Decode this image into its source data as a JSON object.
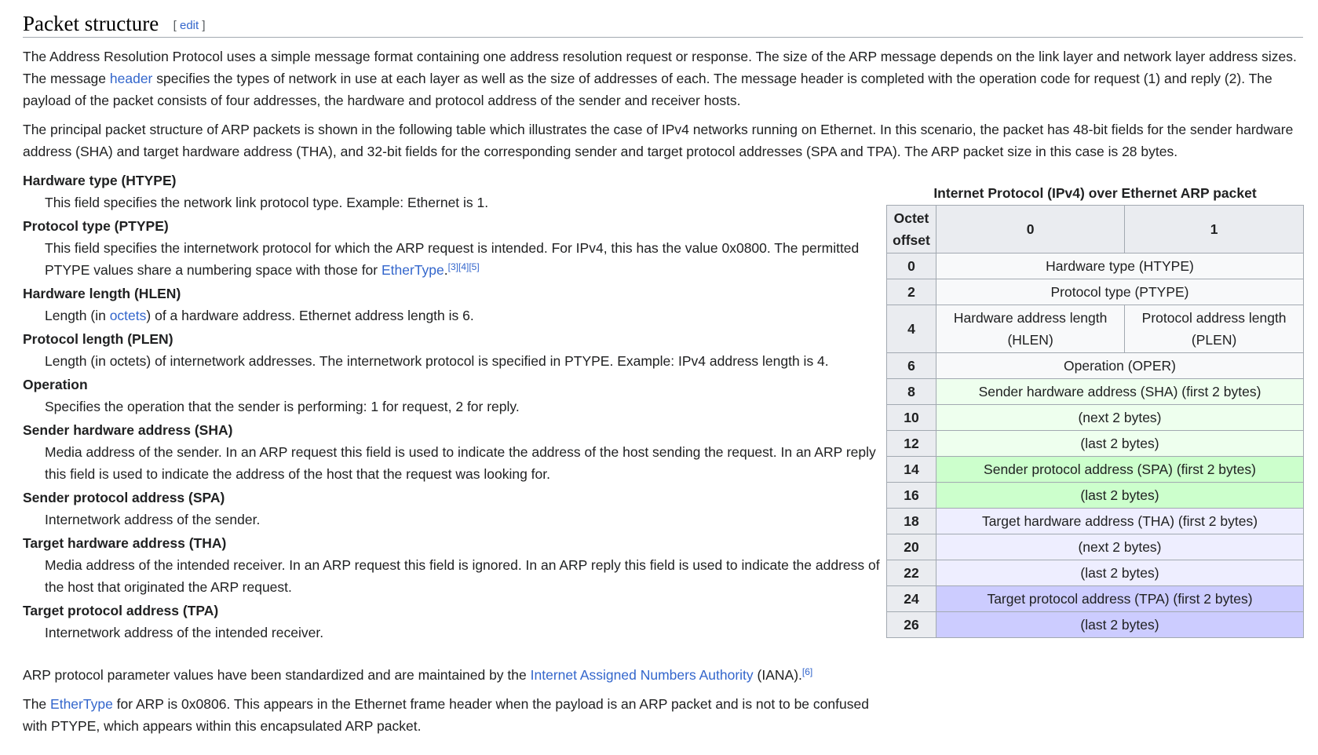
{
  "section": {
    "title": "Packet structure",
    "edit_open": "[ ",
    "edit_label": "edit",
    "edit_close": " ]"
  },
  "intro": {
    "p1_a": "The Address Resolution Protocol uses a simple message format containing one address resolution request or response. The size of the ARP message depends on the link layer and network layer address sizes. The message ",
    "p1_link": "header",
    "p1_b": " specifies the types of network in use at each layer as well as the size of addresses of each. The message header is completed with the operation code for request (1) and reply (2). The payload of the packet consists of four addresses, the hardware and protocol address of the sender and receiver hosts.",
    "p2": "The principal packet structure of ARP packets is shown in the following table which illustrates the case of IPv4 networks running on Ethernet. In this scenario, the packet has 48-bit fields for the sender hardware address (SHA) and target hardware address (THA), and 32-bit fields for the corresponding sender and target protocol addresses (SPA and TPA). The ARP packet size in this case is 28 bytes."
  },
  "fields": {
    "htype_term": "Hardware type (HTYPE)",
    "htype_desc": "This field specifies the network link protocol type. Example: Ethernet is 1.",
    "ptype_term": "Protocol type (PTYPE)",
    "ptype_desc_a": "This field specifies the internetwork protocol for which the ARP request is intended. For IPv4, this has the value 0x0800. The permitted PTYPE values share a numbering space with those for ",
    "ptype_link": "EtherType",
    "ptype_desc_b": ".",
    "ptype_refs": "[3][4][5]",
    "hlen_term": "Hardware length (HLEN)",
    "hlen_desc_a": "Length (in ",
    "hlen_link": "octets",
    "hlen_desc_b": ") of a hardware address. Ethernet address length is 6.",
    "plen_term": "Protocol length (PLEN)",
    "plen_desc": "Length (in octets) of internetwork addresses. The internetwork protocol is specified in PTYPE. Example: IPv4 address length is 4.",
    "oper_term": "Operation",
    "oper_desc": "Specifies the operation that the sender is performing: 1 for request, 2 for reply.",
    "sha_term": "Sender hardware address (SHA)",
    "sha_desc": "Media address of the sender. In an ARP request this field is used to indicate the address of the host sending the request. In an ARP reply this field is used to indicate the address of the host that the request was looking for.",
    "spa_term": "Sender protocol address (SPA)",
    "spa_desc": "Internetwork address of the sender.",
    "tha_term": "Target hardware address (THA)",
    "tha_desc": "Media address of the intended receiver. In an ARP request this field is ignored. In an ARP reply this field is used to indicate the address of the host that originated the ARP request.",
    "tpa_term": "Target protocol address (TPA)",
    "tpa_desc": "Internetwork address of the intended receiver."
  },
  "outro": {
    "p1_a": "ARP protocol parameter values have been standardized and are maintained by the ",
    "p1_link": "Internet Assigned Numbers Authority",
    "p1_b": " (IANA).",
    "p1_ref": "[6]",
    "p2_a": "The ",
    "p2_link": "EtherType",
    "p2_b": " for ARP is 0x0806. This appears in the Ethernet frame header when the payload is an ARP packet and is not to be confused with PTYPE, which appears within this encapsulated ARP packet."
  },
  "table": {
    "caption": "Internet Protocol (IPv4) over Ethernet ARP packet",
    "head_offset": "Octet offset",
    "head_col0": "0",
    "head_col1": "1",
    "rows": [
      {
        "offset": "0",
        "field": "Hardware type (HTYPE)"
      },
      {
        "offset": "2",
        "field": "Protocol type (PTYPE)"
      },
      {
        "offset": "4",
        "field_left": "Hardware address length (HLEN)",
        "field_right": "Protocol address length (PLEN)"
      },
      {
        "offset": "6",
        "field": "Operation (OPER)"
      },
      {
        "offset": "8",
        "field": "Sender hardware address (SHA) (first 2 bytes)"
      },
      {
        "offset": "10",
        "field": "(next 2 bytes)"
      },
      {
        "offset": "12",
        "field": "(last 2 bytes)"
      },
      {
        "offset": "14",
        "field": "Sender protocol address (SPA) (first 2 bytes)"
      },
      {
        "offset": "16",
        "field": "(last 2 bytes)"
      },
      {
        "offset": "18",
        "field": "Target hardware address (THA) (first 2 bytes)"
      },
      {
        "offset": "20",
        "field": "(next 2 bytes)"
      },
      {
        "offset": "22",
        "field": "(last 2 bytes)"
      },
      {
        "offset": "24",
        "field": "Target protocol address (TPA) (first 2 bytes)"
      },
      {
        "offset": "26",
        "field": "(last 2 bytes)"
      }
    ],
    "colors": {
      "sha": "#eeffee",
      "spa": "#ccffcc",
      "tha": "#eeeeff",
      "tpa": "#ccccff"
    }
  }
}
